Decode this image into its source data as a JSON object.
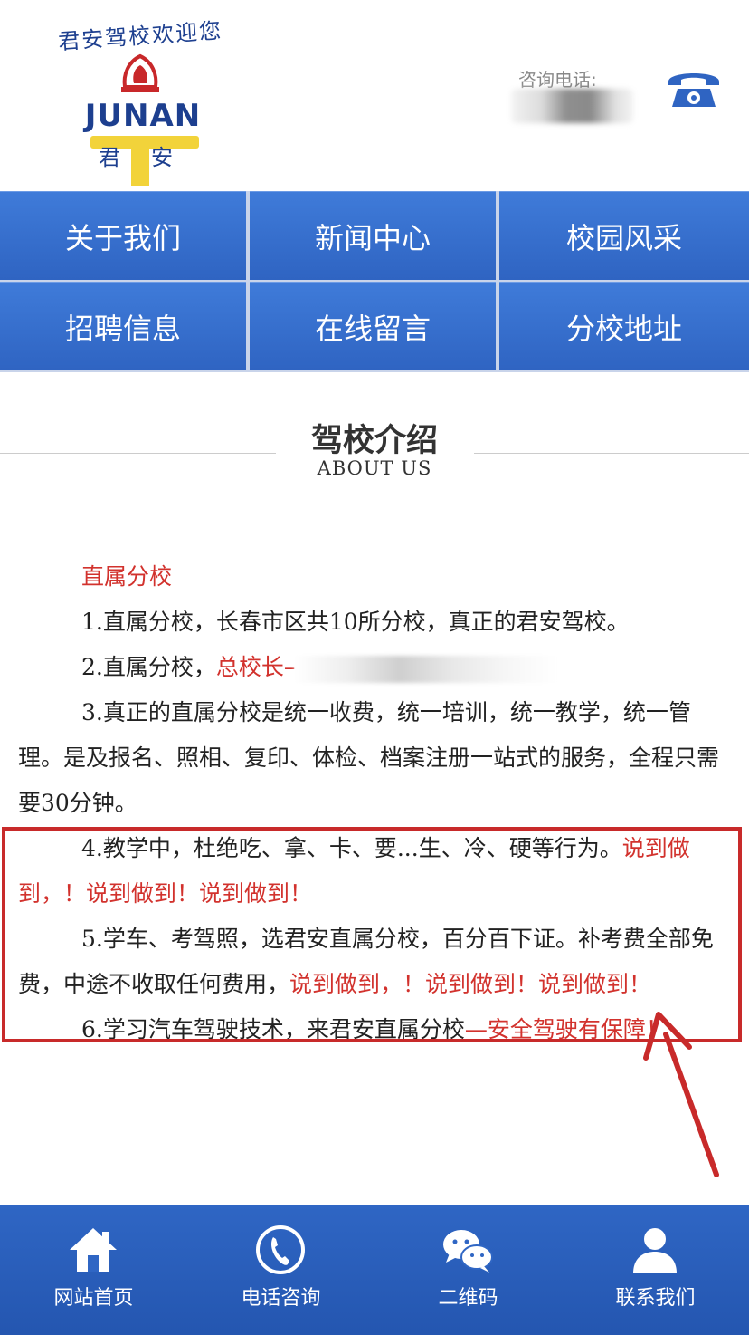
{
  "header": {
    "logo_arc_text": "君安驾校欢迎您",
    "logo_name": "JUNAN",
    "logo_sub": "君安",
    "phone_label": "咨询电话:",
    "phone_icon": "telephone-icon"
  },
  "nav": {
    "items": [
      {
        "label": "关于我们"
      },
      {
        "label": "新闻中心"
      },
      {
        "label": "校园风采"
      },
      {
        "label": "招聘信息"
      },
      {
        "label": "在线留言"
      },
      {
        "label": "分校地址"
      }
    ]
  },
  "section": {
    "title": "驾校介绍",
    "subtitle": "ABOUT US"
  },
  "content": {
    "heading": "直属分校",
    "p1": "1.直属分校，长春市区共10所分校，真正的君安驾校。",
    "p2_prefix": "2.直属分校，",
    "p2_red": "总校长–",
    "p3": "3.真正的直属分校是统一收费，统一培训，统一教学，统一管理。是及报名、照相、复印、体检、档案注册一站式的服务，全程只需要30分钟。",
    "p4_text": "4.教学中，杜绝吃、拿、卡、要...生、冷、硬等行为。",
    "p4_red": "说到做到，！说到做到！说到做到！",
    "p5_text": "5.学车、考驾照，选君安直属分校，百分百下证。补考费全部免费，中途不收取任何费用，",
    "p5_red": "说到做到，！说到做到！说到做到！",
    "p6_text": "6.学习汽车驾驶技术，来君安直属分校",
    "p6_red": "—安全驾驶有保障！"
  },
  "bottom_bar": {
    "tabs": [
      {
        "label": "网站首页",
        "icon": "home-icon"
      },
      {
        "label": "电话咨询",
        "icon": "phone-icon"
      },
      {
        "label": "二维码",
        "icon": "wechat-icon"
      },
      {
        "label": "联系我们",
        "icon": "user-icon"
      }
    ]
  },
  "colors": {
    "nav_blue": "#2f64c2",
    "accent_red": "#d2322d",
    "brand_blue": "#1d3f8f",
    "logo_yellow": "#f2d33a"
  }
}
